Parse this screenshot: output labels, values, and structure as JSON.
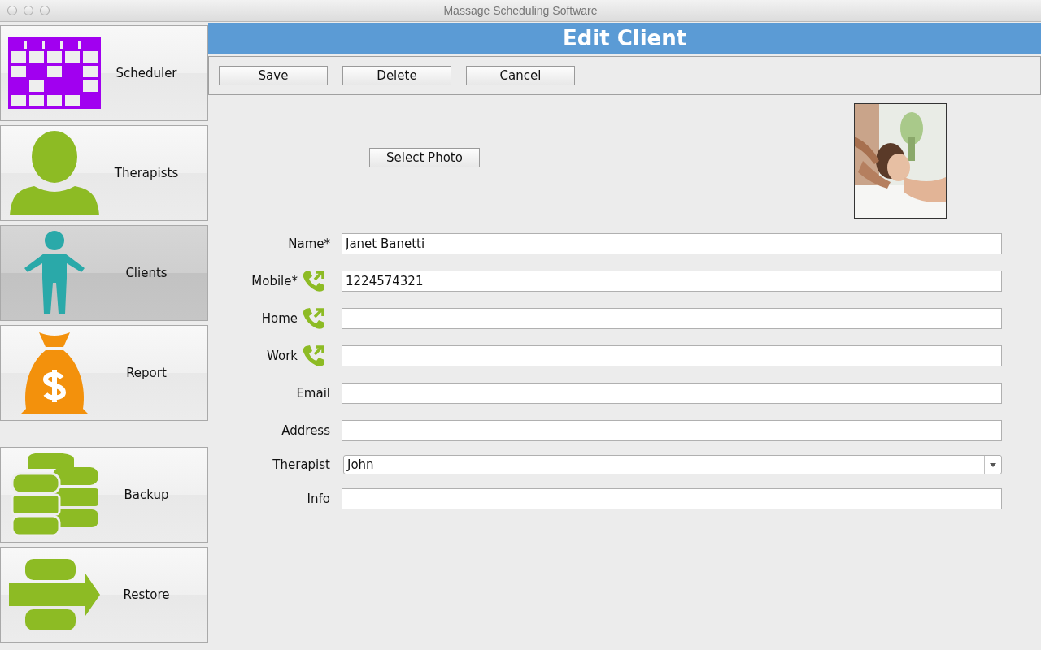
{
  "window": {
    "title": "Massage Scheduling Software"
  },
  "sidebar": {
    "items": [
      {
        "label": "Scheduler",
        "kind": "calendar",
        "selected": false
      },
      {
        "label": "Therapists",
        "kind": "person",
        "selected": false
      },
      {
        "label": "Clients",
        "kind": "figure",
        "selected": true
      },
      {
        "label": "Report",
        "kind": "moneybag",
        "selected": false
      },
      {
        "label": "Backup",
        "kind": "databases",
        "selected": false
      },
      {
        "label": "Restore",
        "kind": "restore",
        "selected": false
      }
    ]
  },
  "header": {
    "title": "Edit Client"
  },
  "toolbar": {
    "buttons": [
      "Save",
      "Delete",
      "Cancel"
    ]
  },
  "photo": {
    "button": "Select Photo",
    "kind": "picture"
  },
  "field_groups": [
    [
      {
        "label": "Name*",
        "kind": "text",
        "value": "Janet Banetti"
      },
      {
        "label": "Mobile*",
        "kind": "phone",
        "value": "1224574321"
      },
      {
        "label": "Home",
        "kind": "phone"
      },
      {
        "label": "Work",
        "kind": "phone"
      },
      {
        "label": "Email",
        "kind": "text"
      }
    ],
    [
      {
        "label": "Address",
        "kind": "text"
      },
      {
        "label": "Therapist",
        "kind": "select",
        "value": "John"
      },
      {
        "label": "Info",
        "kind": "text"
      }
    ]
  ]
}
